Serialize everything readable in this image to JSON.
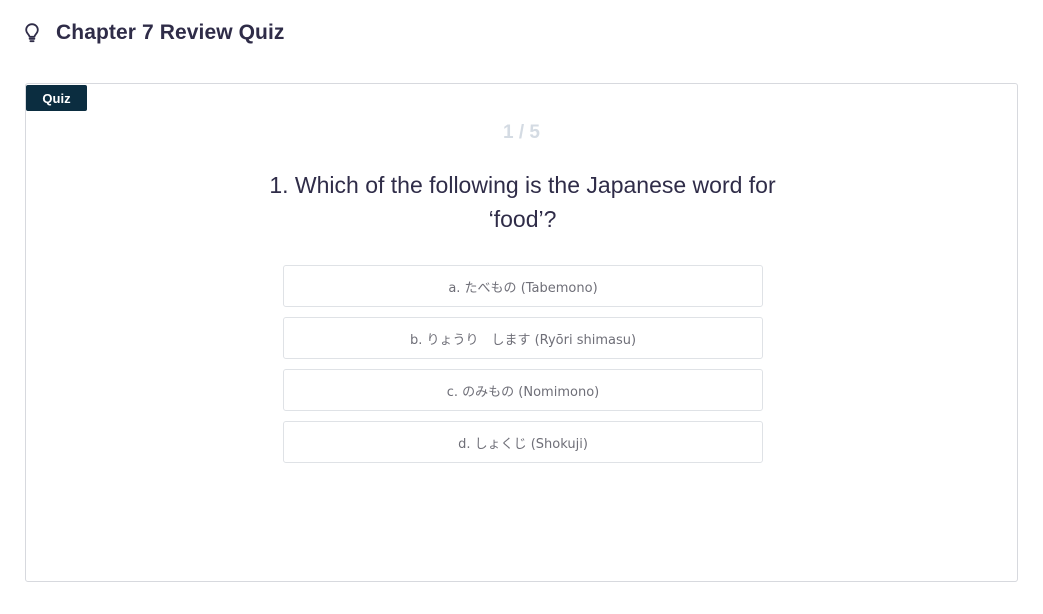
{
  "header": {
    "icon": "lightbulb-icon",
    "title": "Chapter 7 Review Quiz"
  },
  "quiz": {
    "badge": "Quiz",
    "progress_text": "1 / 5",
    "question_line1": "1. Which of the following is the Japanese word for",
    "question_line2": "‘food’?",
    "options": [
      {
        "label": "a. たべもの (Tabemono)"
      },
      {
        "label": "b. りょうり　します (Ryōri shimasu)"
      },
      {
        "label": "c. のみもの (Nomimono)"
      },
      {
        "label": "d. しょくじ (Shokuji)"
      }
    ]
  },
  "colors": {
    "title": "#2f2c48",
    "badge_bg": "#0b2d40",
    "progress": "#d4dbe3",
    "option_border": "#dfe2e6",
    "option_text": "#6f6f78"
  }
}
